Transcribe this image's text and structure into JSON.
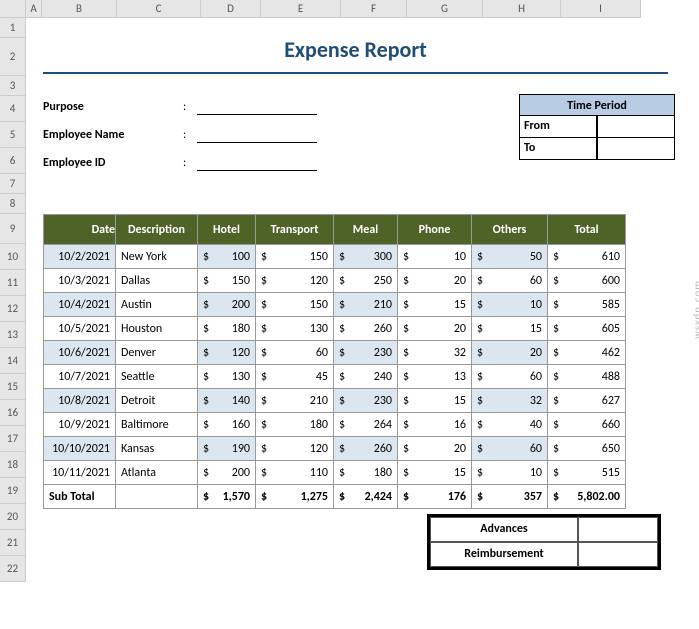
{
  "col_headers": [
    "A",
    "B",
    "C",
    "D",
    "E",
    "F",
    "G",
    "H",
    "I"
  ],
  "row_headers": [
    "1",
    "2",
    "3",
    "4",
    "5",
    "6",
    "7",
    "8",
    "9",
    "10",
    "11",
    "12",
    "13",
    "14",
    "15",
    "16",
    "17",
    "18",
    "19",
    "20",
    "21",
    "22"
  ],
  "title": "Expense Report",
  "form": {
    "purpose": "Purpose",
    "employee_name": "Employee Name",
    "employee_id": "Employee ID",
    "colon": ":"
  },
  "time_period": {
    "header": "Time Period",
    "from": "From",
    "to": "To"
  },
  "table": {
    "headers": [
      "Date",
      "Description",
      "Hotel",
      "Transport",
      "Meal",
      "Phone",
      "Others",
      "Total"
    ],
    "rows": [
      {
        "date": "10/2/2021",
        "desc": "New York",
        "hotel": 100,
        "transport": 150,
        "meal": 300,
        "phone": 10,
        "others": 50,
        "total": 610
      },
      {
        "date": "10/3/2021",
        "desc": "Dallas",
        "hotel": 150,
        "transport": 120,
        "meal": 250,
        "phone": 20,
        "others": 60,
        "total": 600
      },
      {
        "date": "10/4/2021",
        "desc": "Austin",
        "hotel": 200,
        "transport": 150,
        "meal": 210,
        "phone": 15,
        "others": 10,
        "total": 585
      },
      {
        "date": "10/5/2021",
        "desc": "Houston",
        "hotel": 180,
        "transport": 130,
        "meal": 260,
        "phone": 20,
        "others": 15,
        "total": 605
      },
      {
        "date": "10/6/2021",
        "desc": "Denver",
        "hotel": 120,
        "transport": 60,
        "meal": 230,
        "phone": 32,
        "others": 20,
        "total": 462
      },
      {
        "date": "10/7/2021",
        "desc": "Seattle",
        "hotel": 130,
        "transport": 45,
        "meal": 240,
        "phone": 13,
        "others": 60,
        "total": 488
      },
      {
        "date": "10/8/2021",
        "desc": "Detroit",
        "hotel": 140,
        "transport": 210,
        "meal": 230,
        "phone": 15,
        "others": 32,
        "total": 627
      },
      {
        "date": "10/9/2021",
        "desc": "Baltimore",
        "hotel": 160,
        "transport": 180,
        "meal": 264,
        "phone": 16,
        "others": 40,
        "total": 660
      },
      {
        "date": "10/10/2021",
        "desc": "Kansas",
        "hotel": 190,
        "transport": 120,
        "meal": 260,
        "phone": 20,
        "others": 60,
        "total": 650
      },
      {
        "date": "10/11/2021",
        "desc": "Atlanta",
        "hotel": 200,
        "transport": 110,
        "meal": 180,
        "phone": 15,
        "others": 10,
        "total": 515
      }
    ],
    "subtotal": {
      "label": "Sub Total",
      "hotel": "1,570",
      "transport": "1,275",
      "meal": "2,424",
      "phone": "176",
      "others": "357",
      "total": "5,802.00"
    }
  },
  "footer": {
    "advances": "Advances",
    "reimbursement": "Reimbursement"
  },
  "currency": "$",
  "watermark": "wsxdn.com"
}
